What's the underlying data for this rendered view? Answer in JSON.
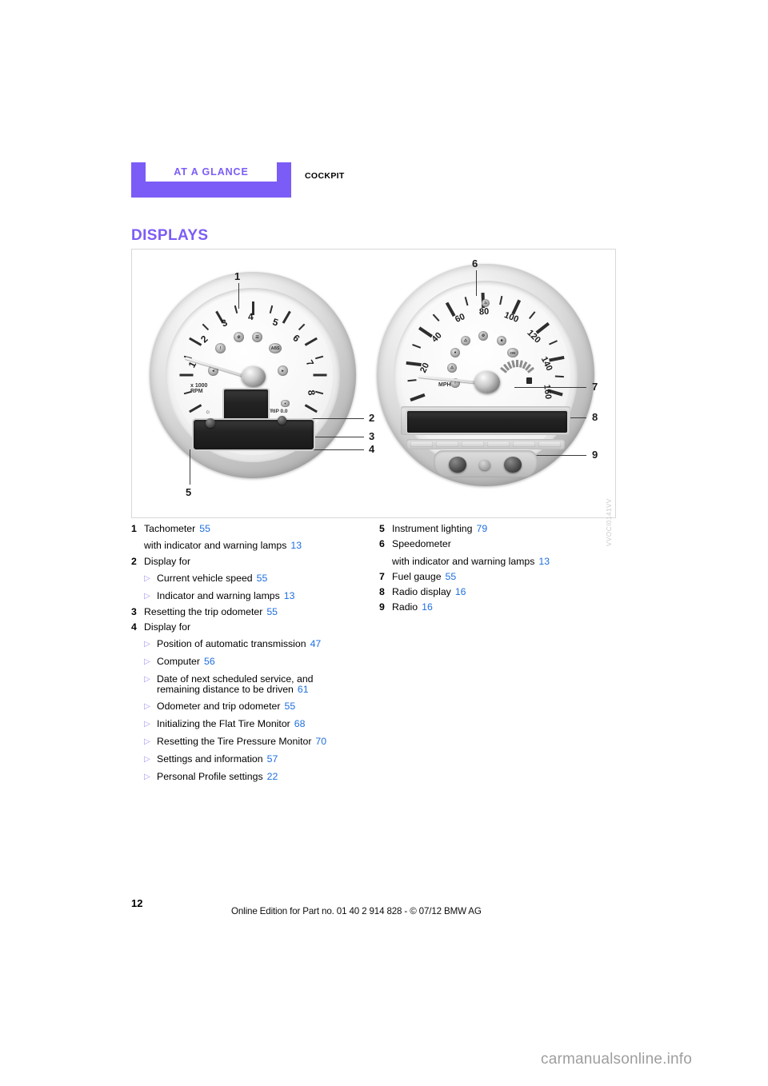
{
  "header": {
    "chapter": "AT A GLANCE",
    "section": "COCKPIT"
  },
  "title": "DISPLAYS",
  "figure": {
    "code": "VVOCI0141VV",
    "callouts": [
      "1",
      "2",
      "3",
      "4",
      "5",
      "6",
      "7",
      "8",
      "9"
    ],
    "tachometer": {
      "scale": [
        "1",
        "2",
        "3",
        "4",
        "5",
        "6",
        "7",
        "8"
      ],
      "unit_line1": "x 1000",
      "unit_line2": "RPM",
      "trip_label": "TRIP 0.0",
      "abs_lamp": "ABS"
    },
    "speedometer": {
      "scale": [
        "20",
        "40",
        "60",
        "80",
        "100",
        "120",
        "140",
        "160"
      ],
      "unit": "MPH"
    }
  },
  "legend": {
    "left": [
      {
        "num": "1",
        "lines": [
          {
            "text": "Tachometer",
            "page": "55"
          },
          {
            "text": "with indicator and warning lamps",
            "page": "13"
          }
        ],
        "sub": []
      },
      {
        "num": "2",
        "lines": [
          {
            "text": "Display for",
            "page": ""
          }
        ],
        "sub": [
          {
            "text": "Current vehicle speed",
            "page": "55"
          },
          {
            "text": "Indicator and warning lamps",
            "page": "13"
          }
        ]
      },
      {
        "num": "3",
        "lines": [
          {
            "text": "Resetting the trip odometer",
            "page": "55"
          }
        ],
        "sub": []
      },
      {
        "num": "4",
        "lines": [
          {
            "text": "Display for",
            "page": ""
          }
        ],
        "sub": [
          {
            "text": "Position of automatic transmission",
            "page": "47"
          },
          {
            "text": "Computer",
            "page": "56"
          },
          {
            "text": "Date of next scheduled service, and",
            "text2": "remaining distance to be driven",
            "page": "61"
          },
          {
            "text": "Odometer and trip odometer",
            "page": "55"
          },
          {
            "text": "Initializing the Flat Tire Monitor",
            "page": "68"
          },
          {
            "text": "Resetting the Tire Pressure Monitor",
            "page": "70"
          },
          {
            "text": "Settings and information",
            "page": "57"
          },
          {
            "text": "Personal Profile settings",
            "page": "22"
          }
        ]
      }
    ],
    "right": [
      {
        "num": "5",
        "lines": [
          {
            "text": "Instrument lighting",
            "page": "79"
          }
        ],
        "sub": []
      },
      {
        "num": "6",
        "lines": [
          {
            "text": "Speedometer",
            "page": ""
          },
          {
            "text": "with indicator and warning lamps",
            "page": "13"
          }
        ],
        "sub": []
      },
      {
        "num": "7",
        "lines": [
          {
            "text": "Fuel gauge",
            "page": "55"
          }
        ],
        "sub": []
      },
      {
        "num": "8",
        "lines": [
          {
            "text": "Radio display",
            "page": "16"
          }
        ],
        "sub": []
      },
      {
        "num": "9",
        "lines": [
          {
            "text": "Radio",
            "page": "16"
          }
        ],
        "sub": []
      }
    ]
  },
  "footer": {
    "page_number": "12",
    "note": "Online Edition for Part no. 01 40 2 914 828 - © 07/12 BMW AG",
    "watermark": "carmanualsonline.info"
  },
  "colors": {
    "accent_purple": "#7c5cf6",
    "link_blue": "#1f6fe0",
    "bullet_purple": "#a892f7"
  }
}
